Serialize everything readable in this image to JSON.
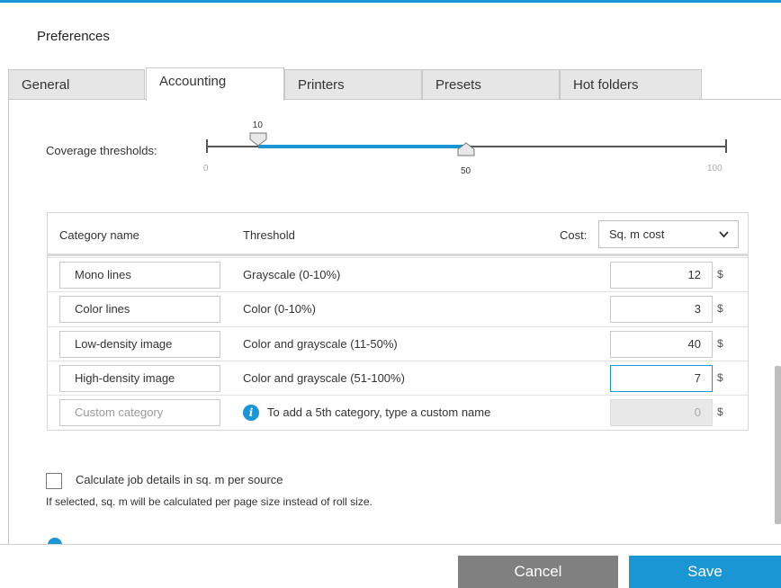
{
  "window": {
    "title": "Preferences"
  },
  "tabs": [
    {
      "label": "General"
    },
    {
      "label": "Accounting",
      "active": true
    },
    {
      "label": "Printers"
    },
    {
      "label": "Presets"
    },
    {
      "label": "Hot folders"
    }
  ],
  "coverage": {
    "label": "Coverage thresholds:",
    "min": 0,
    "max": 100,
    "min_label": "0",
    "max_label": "100",
    "low_value": "10",
    "high_value": "50"
  },
  "table": {
    "headers": {
      "category": "Category name",
      "threshold": "Threshold",
      "cost": "Cost:"
    },
    "cost_select": {
      "value": "Sq. m cost",
      "chevron": "chevron-down-icon"
    },
    "rows": [
      {
        "name": "Mono lines",
        "threshold": "Grayscale  (0-10%)",
        "cost": "12",
        "currency": "$"
      },
      {
        "name": "Color lines",
        "threshold": "Color  (0-10%)",
        "cost": "3",
        "currency": "$"
      },
      {
        "name": "Low-density image",
        "threshold": "Color and grayscale  (11-50%)",
        "cost": "40",
        "currency": "$"
      },
      {
        "name": "High-density image",
        "threshold": "Color and grayscale  (51-100%)",
        "cost": "7",
        "currency": "$"
      }
    ],
    "custom_row": {
      "placeholder": "Custom category",
      "info_text": "To add a 5th category, type a custom name",
      "cost": "0",
      "currency": "$"
    }
  },
  "options": {
    "calc_label": "Calculate job details in sq. m per source",
    "calc_checked": false,
    "calc_help": "If selected, sq. m will be calculated per page size instead of roll size."
  },
  "footer": {
    "cancel": "Cancel",
    "save": "Save"
  },
  "colors": {
    "accent": "#1a96d4",
    "cancel_bg": "#808080"
  }
}
